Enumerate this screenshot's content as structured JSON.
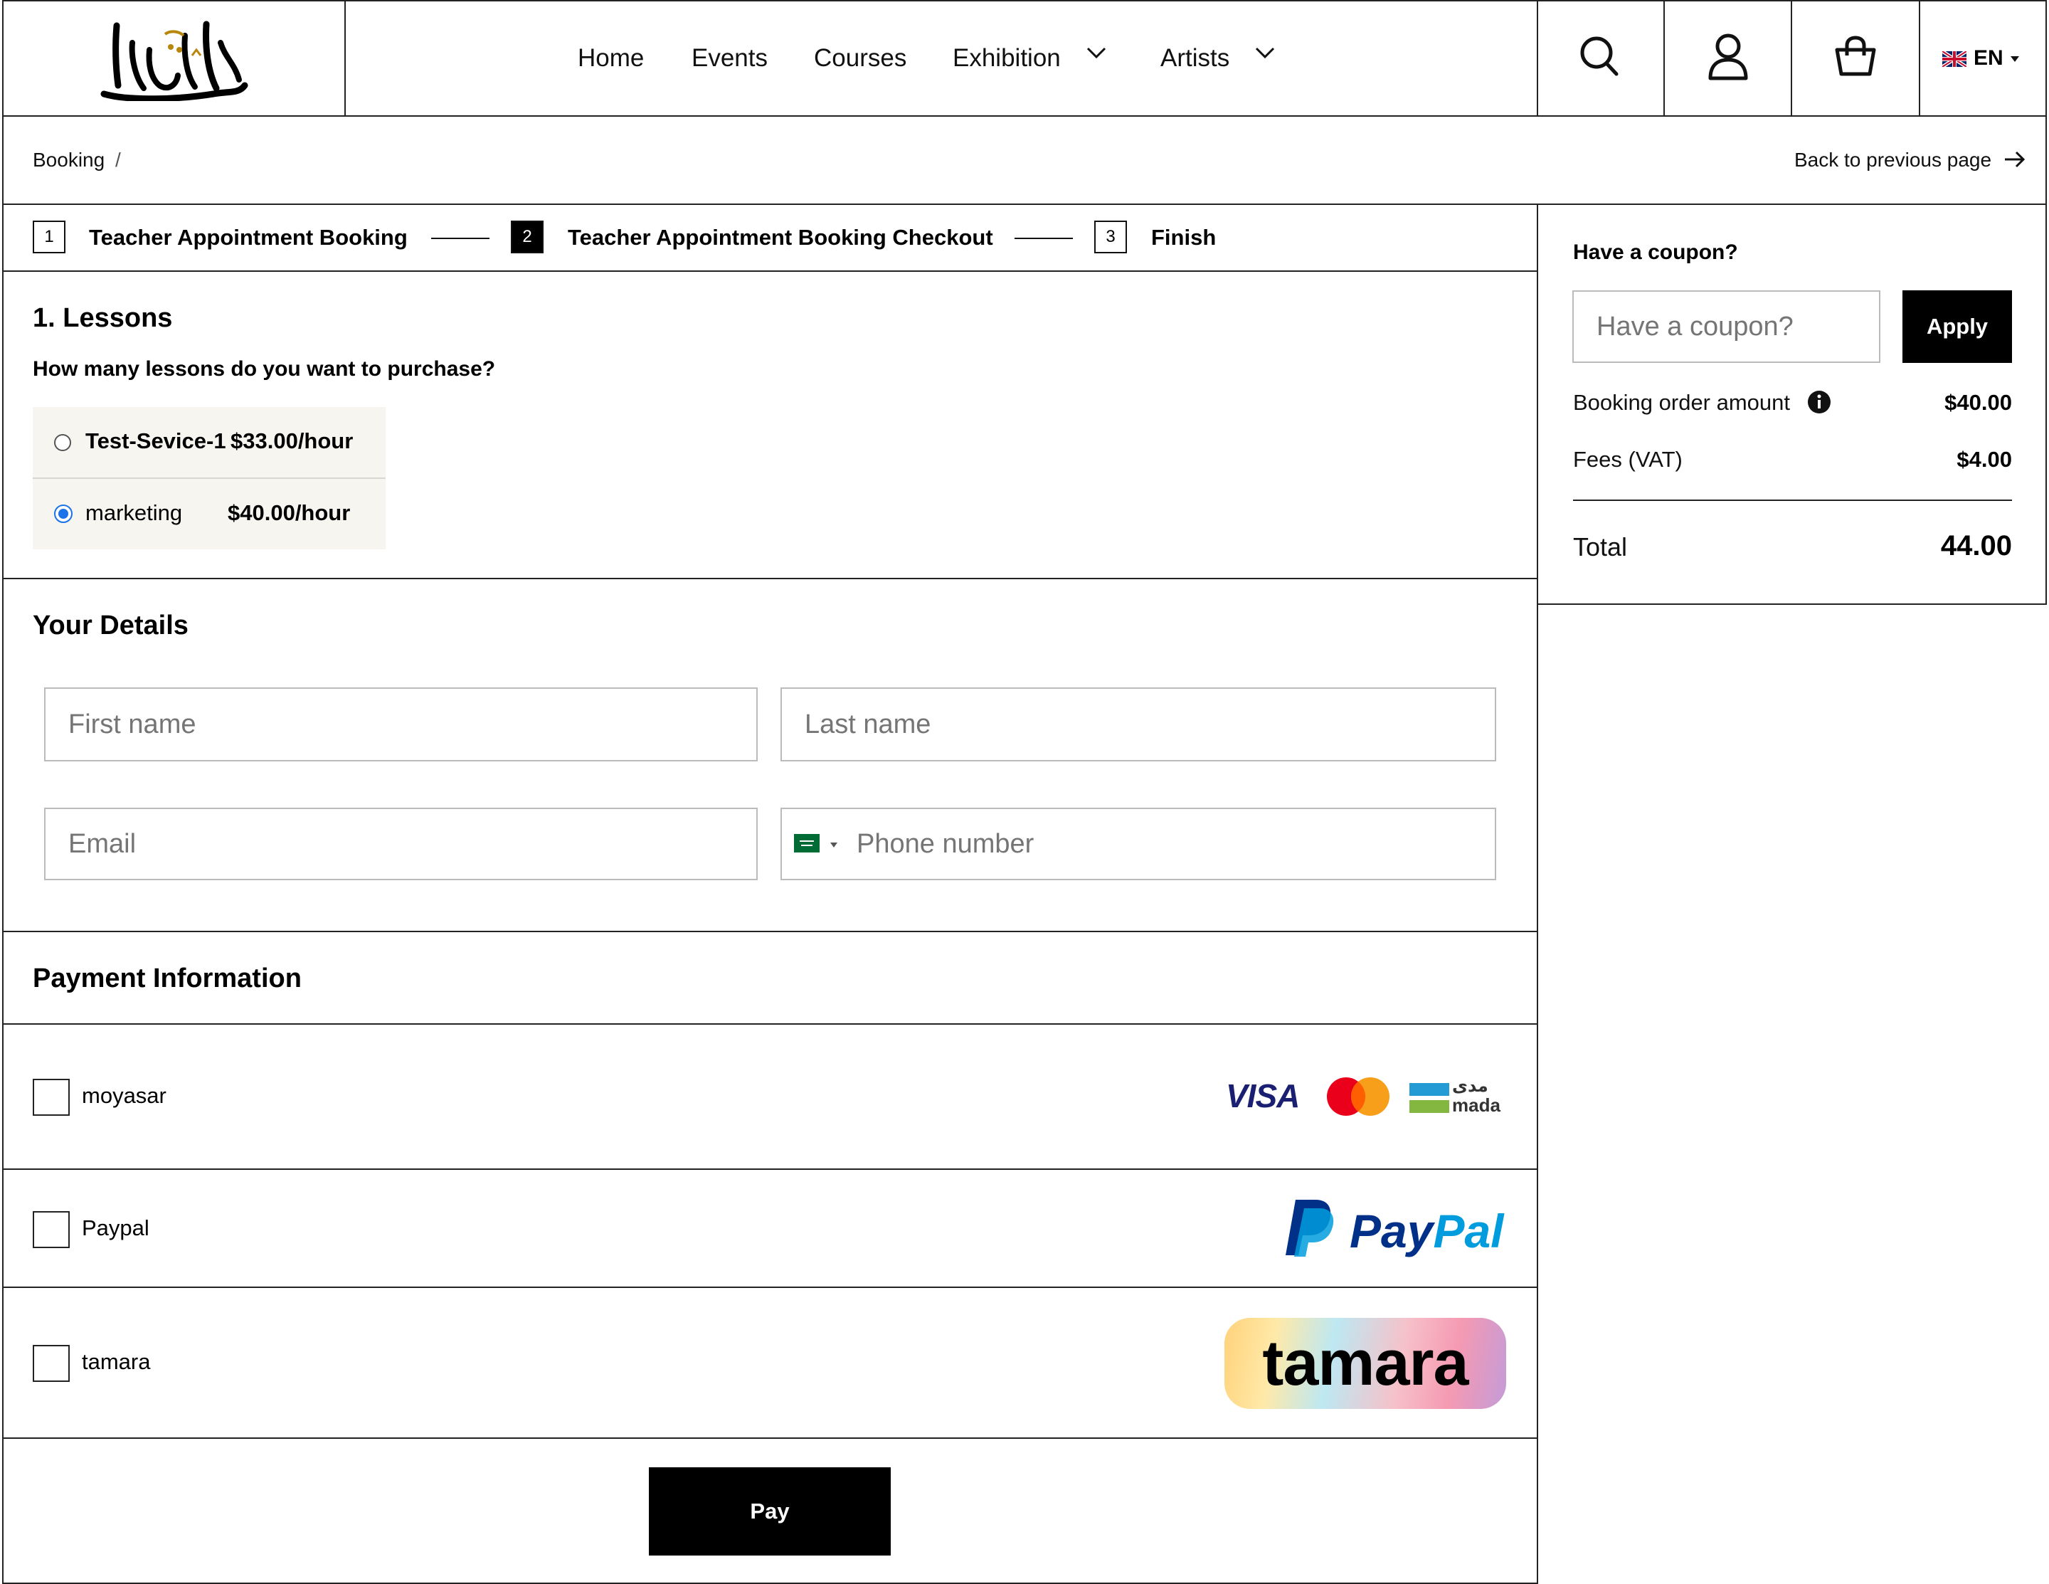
{
  "header": {
    "nav": [
      {
        "label": "Home"
      },
      {
        "label": "Events"
      },
      {
        "label": "Courses"
      },
      {
        "label": "Exhibition"
      },
      {
        "label": "Artists"
      }
    ],
    "language": "EN"
  },
  "breadcrumb": {
    "current": "Booking",
    "separator": "/",
    "back_label": "Back to previous page"
  },
  "stepper": [
    {
      "num": "1",
      "label": "Teacher Appointment Booking"
    },
    {
      "num": "2",
      "label": "Teacher Appointment Booking Checkout"
    },
    {
      "num": "3",
      "label": "Finish"
    }
  ],
  "lessons": {
    "title": "1. Lessons",
    "question": "How many lessons do you want to purchase?",
    "options": [
      {
        "name": "Test-Sevice-1",
        "price": "$33.00/hour",
        "selected": false
      },
      {
        "name": "marketing",
        "price": "$40.00/hour",
        "selected": true
      }
    ]
  },
  "details": {
    "title": "Your Details",
    "first_name_placeholder": "First name",
    "last_name_placeholder": "Last name",
    "email_placeholder": "Email",
    "phone_placeholder": "Phone number"
  },
  "payment": {
    "title": "Payment Information",
    "methods": [
      {
        "label": "moyasar",
        "checked": false
      },
      {
        "label": "Paypal",
        "checked": false
      },
      {
        "label": "tamara",
        "checked": false
      }
    ],
    "brand_text": {
      "visa": "VISA",
      "mada_ar": "مدى",
      "mada": "mada",
      "paypal_pay": "Pay",
      "paypal_pal": "Pal",
      "tamara": "tamara"
    },
    "pay_label": "Pay"
  },
  "summary": {
    "coupon_title": "Have a coupon?",
    "coupon_placeholder": "Have a coupon?",
    "apply_label": "Apply",
    "order_amount_label": "Booking order amount",
    "order_amount": "$40.00",
    "fees_label": "Fees (VAT)",
    "fees": "$4.00",
    "total_label": "Total",
    "total": "44.00"
  },
  "colors": {
    "accent": "#000000",
    "radio_selected": "#1a73e8",
    "option_bg": "#f6f5ef",
    "border": "#222222",
    "visa_blue": "#1a1f71",
    "mc_red": "#eb001b",
    "mc_yellow": "#f79e1b",
    "mada_blue": "#259bd6",
    "mada_green": "#84b740",
    "paypal_dark": "#003087",
    "paypal_light": "#009cde"
  }
}
